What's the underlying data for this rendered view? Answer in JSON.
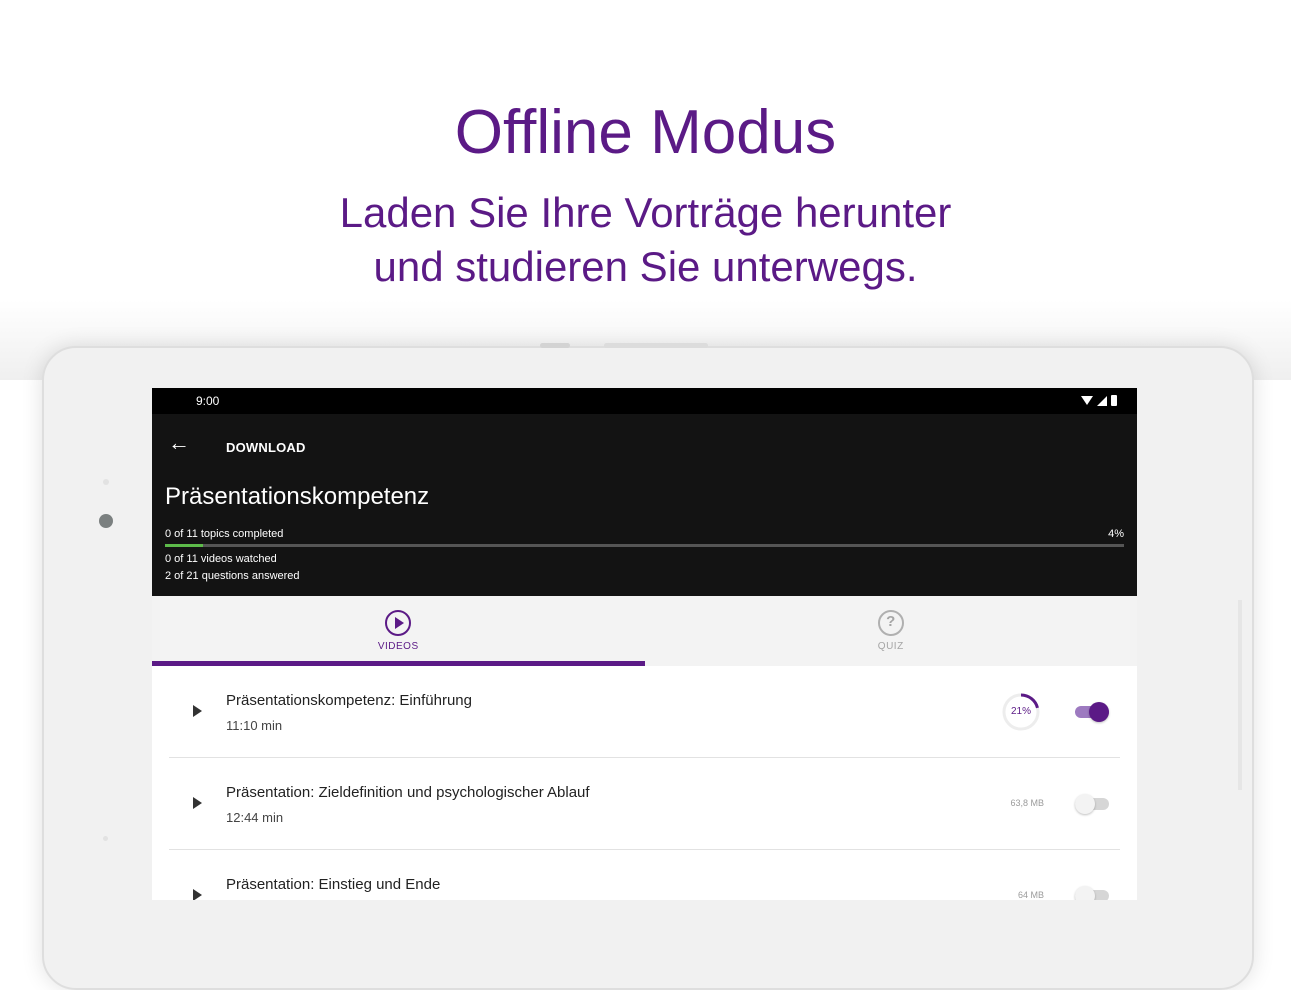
{
  "hero": {
    "title": "Offline Modus",
    "subtitle_line1": "Laden Sie Ihre Vorträge herunter",
    "subtitle_line2": "und studieren Sie unterwegs."
  },
  "statusbar": {
    "time": "9:00"
  },
  "appbar": {
    "title": "DOWNLOAD",
    "course_title": "Präsentationskompetenz",
    "topics_completed": "0 of 11 topics completed",
    "progress_percent_label": "4%",
    "progress_fraction": 0.04,
    "videos_watched": "0 of 11 videos watched",
    "questions_answered": "2 of 21 questions answered"
  },
  "tabs": [
    {
      "label": "VIDEOS",
      "icon": "play-circle-icon",
      "active": true
    },
    {
      "label": "QUIZ",
      "icon": "help-circle-icon",
      "active": false
    }
  ],
  "videos": [
    {
      "title": "Präsentationskompetenz: Einführung",
      "duration": "11:10 min",
      "download_progress_label": "21%",
      "download_progress": 0.21,
      "enabled": true
    },
    {
      "title": "Präsentation: Zieldefinition und psychologischer Ablauf",
      "duration": "12:44 min",
      "size": "63,8 MB",
      "enabled": false
    },
    {
      "title": "Präsentation: Einstieg und Ende",
      "duration": "",
      "size": "64 MB",
      "enabled": false
    }
  ],
  "colors": {
    "brand": "#5b1a86",
    "progress": "#5dbb4a",
    "appbar": "#131313"
  }
}
